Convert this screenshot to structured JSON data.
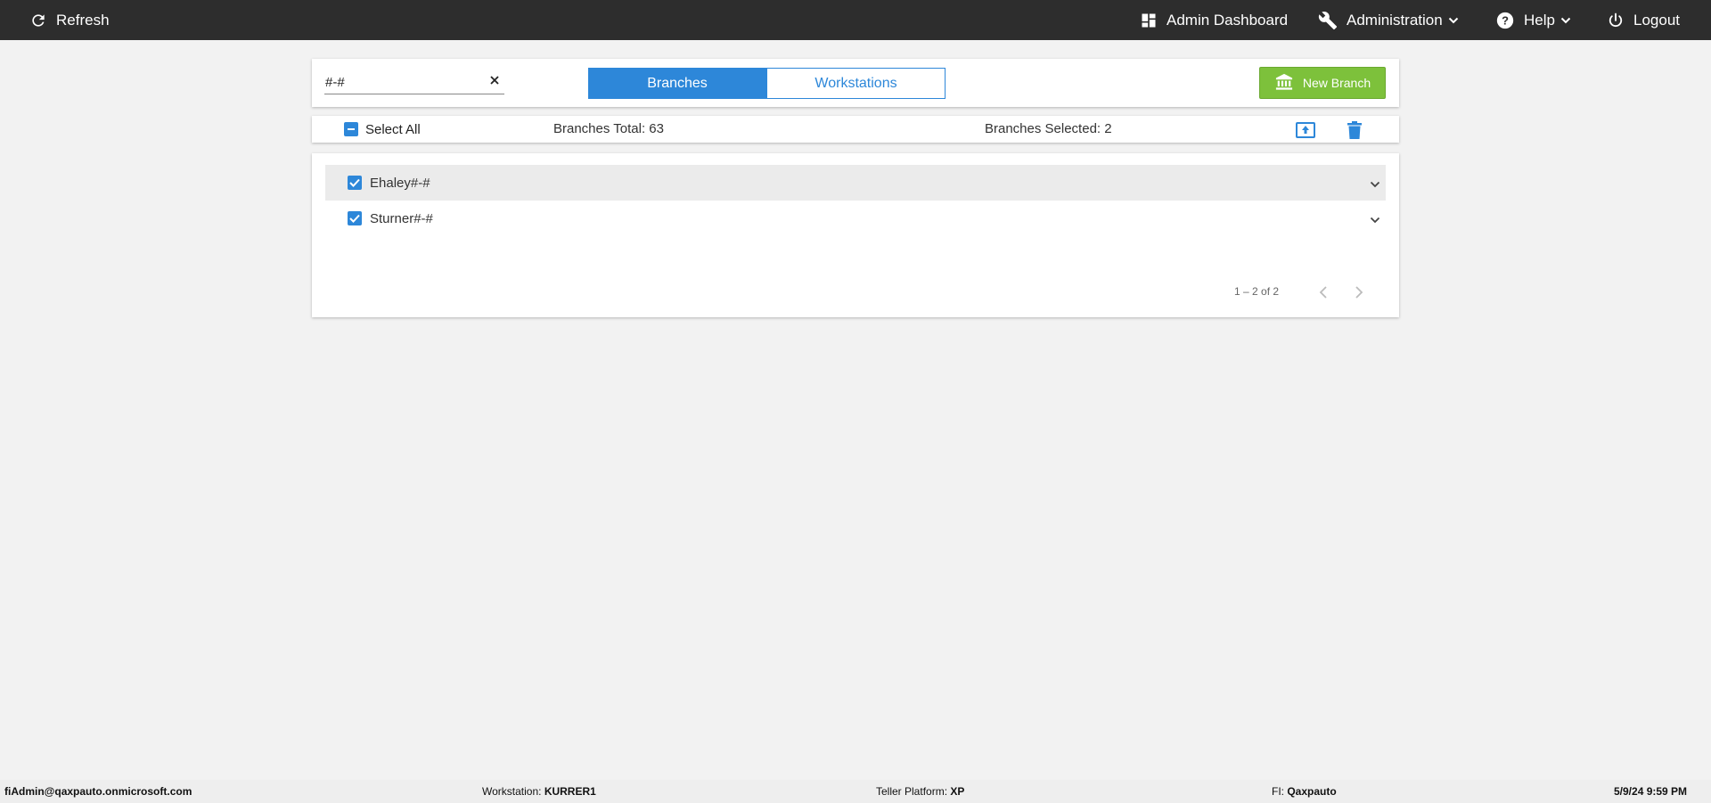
{
  "topbar": {
    "refresh_label": "Refresh",
    "admin_dashboard_label": "Admin Dashboard",
    "administration_label": "Administration",
    "help_label": "Help",
    "logout_label": "Logout"
  },
  "search": {
    "value": "#-#",
    "placeholder": ""
  },
  "tabs": {
    "branches": "Branches",
    "workstations": "Workstations",
    "active": "Branches"
  },
  "new_branch_label": "New Branch",
  "select_bar": {
    "select_all_label": "Select All",
    "total_text": "Branches Total: 63",
    "selected_text": "Branches Selected: 2"
  },
  "branches": [
    {
      "name": "Ehaley#-#",
      "checked": true
    },
    {
      "name": "Sturner#-#",
      "checked": true
    }
  ],
  "pagination": {
    "range_text": "1 – 2 of 2"
  },
  "footer": {
    "user": "fiAdmin@qaxpauto.onmicrosoft.com",
    "workstation_label": "Workstation:",
    "workstation_value": "KURRER1",
    "teller_platform_label": "Teller Platform:",
    "teller_platform_value": "XP",
    "fi_label": "FI:",
    "fi_value": "Qaxpauto",
    "datetime": "5/9/24 9:59 PM"
  },
  "colors": {
    "topbar_bg": "#2d2d2d",
    "accent_blue": "#2d87d9",
    "new_branch_green": "#7dc13b",
    "page_bg": "#f2f2f2"
  },
  "icons": [
    "refresh-icon",
    "dashboard-icon",
    "wrench-icon",
    "help-icon",
    "power-icon",
    "clear-icon",
    "bank-icon",
    "export-icon",
    "trash-icon",
    "chevron-down-icon",
    "chevron-left-icon",
    "chevron-right-icon"
  ]
}
